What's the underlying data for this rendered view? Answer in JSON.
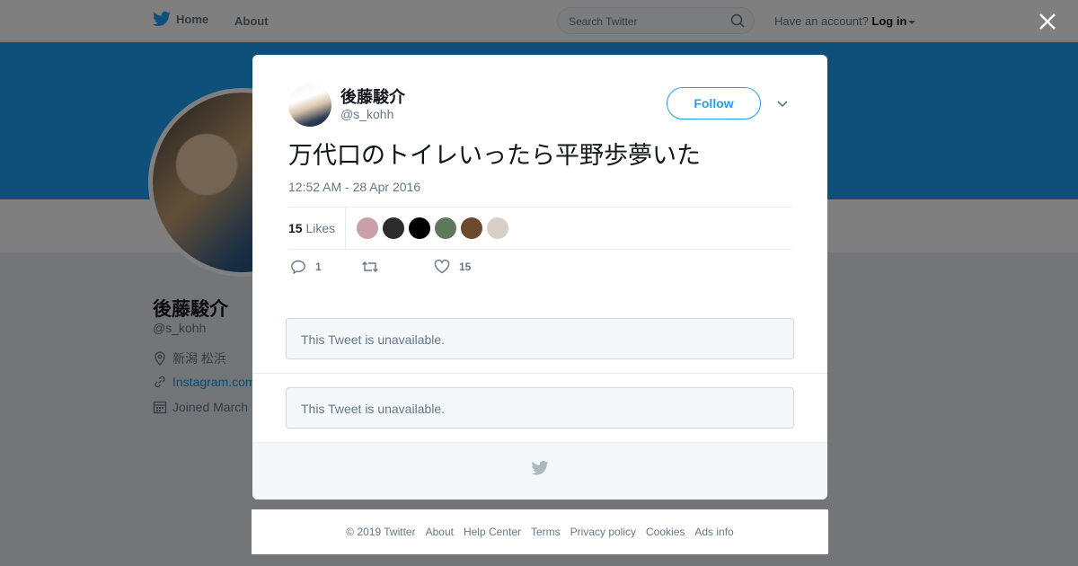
{
  "topbar": {
    "home_label": "Home",
    "about_label": "About",
    "search_placeholder": "Search Twitter",
    "account_prompt": "Have an account?",
    "login_label": "Log in"
  },
  "profile": {
    "name": "後藤駿介",
    "handle": "@s_kohh",
    "location": "新潟 松浜",
    "link": "Instagram.com",
    "joined": "Joined March"
  },
  "tweet": {
    "author_name": "後藤駿介",
    "author_handle": "@s_kohh",
    "follow_label": "Follow",
    "text": "万代口のトイレいったら平野歩夢いた",
    "timestamp": "12:52 AM - 28 Apr 2016",
    "likes_count": "15",
    "likes_label": "Likes",
    "reply_count": "1",
    "retweet_count": "",
    "like_count": "15",
    "liker_colors": [
      "#c9a0a8",
      "#2b2b2b",
      "#000000",
      "#5f7a5a",
      "#6b4a2e",
      "#d8cfc7"
    ]
  },
  "unavailable": [
    {
      "text": "This Tweet is unavailable."
    },
    {
      "text": "This Tweet is unavailable."
    }
  ],
  "footer": {
    "copyright": "© 2019 Twitter",
    "links": [
      "About",
      "Help Center",
      "Terms",
      "Privacy policy",
      "Cookies",
      "Ads info"
    ]
  },
  "colors": {
    "brand": "#1da1f2",
    "muted": "#657786",
    "background": "#e6ecf0"
  },
  "icons": {
    "logo": "twitter-bird-icon",
    "close": "close-icon",
    "search": "search-icon"
  }
}
